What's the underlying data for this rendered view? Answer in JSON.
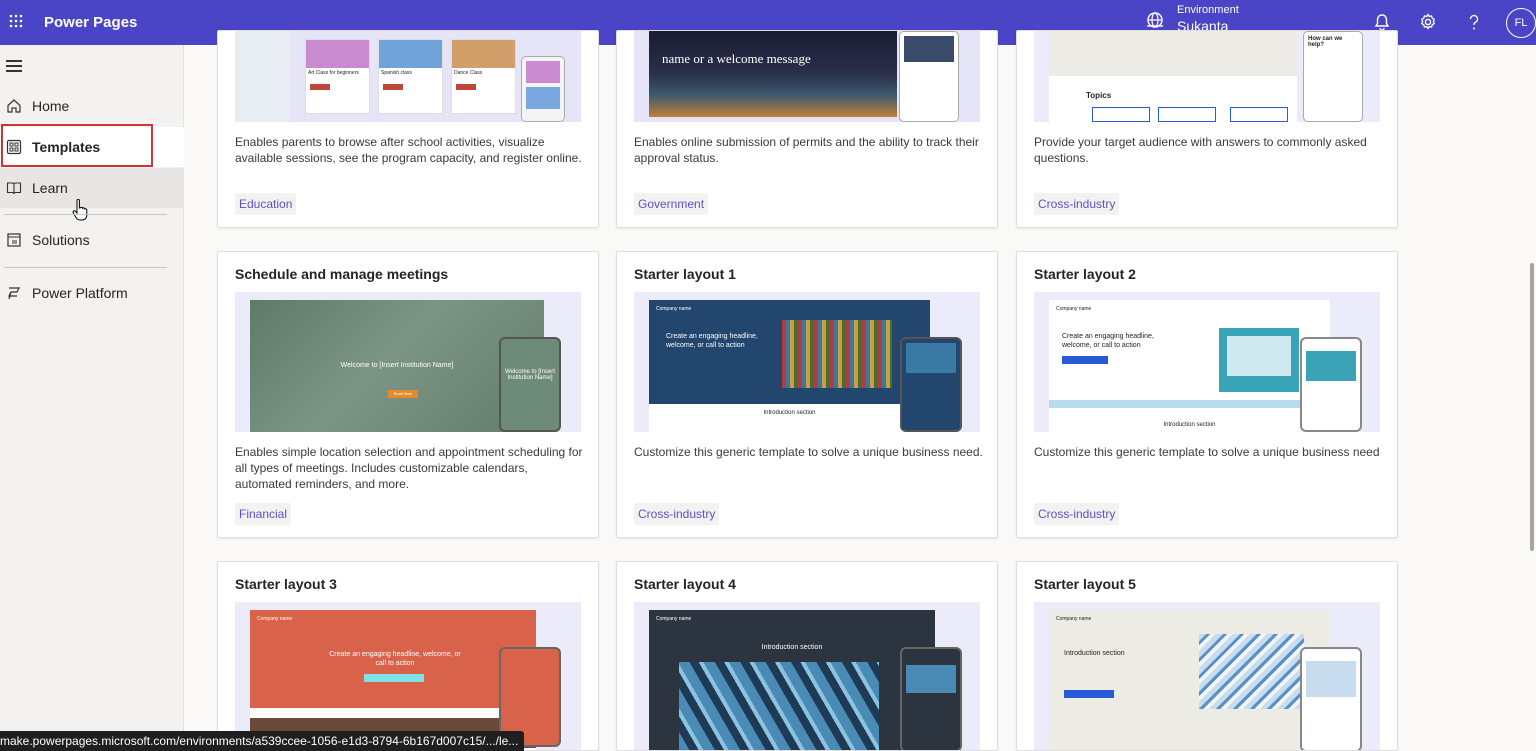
{
  "topbar": {
    "app_title": "Power Pages",
    "environment_label": "Environment",
    "environment_name": "Sukanta",
    "user_initials": "FL",
    "icons": [
      "waffle-icon",
      "globe-icon",
      "bell-icon",
      "gear-icon",
      "help-icon"
    ]
  },
  "sidebar": {
    "items": [
      {
        "label": "Home",
        "icon": "home-icon"
      },
      {
        "label": "Templates",
        "icon": "templates-icon",
        "selected": true
      },
      {
        "label": "Learn",
        "icon": "book-icon"
      },
      {
        "label": "Solutions",
        "icon": "solutions-icon"
      },
      {
        "label": "Power Platform",
        "icon": "power-platform-icon"
      }
    ]
  },
  "cards": [
    {
      "title": "",
      "description": "Enables parents to browse after school activities, visualize available sessions, see the program capacity, and register online.",
      "tag": "Education",
      "preview_text": [
        "Art Class for beginners",
        "Spanish class",
        "Dance Class"
      ]
    },
    {
      "title": "",
      "description": "Enables online submission of permits and the ability to track their approval status.",
      "tag": "Government",
      "preview_text": [
        "name or a welcome message"
      ]
    },
    {
      "title": "",
      "description": "Provide your target audience with answers to commonly asked questions.",
      "tag": "Cross-industry",
      "preview_text": [
        "Topics",
        "How can we help?"
      ]
    },
    {
      "title": "Schedule and manage meetings",
      "description": "Enables simple location selection and appointment scheduling for all types of meetings. Includes customizable calendars, automated reminders, and more.",
      "tag": "Financial",
      "preview_text": [
        "Welcome to [Insert Institution Name]",
        "Book Now",
        "Welcome to [Insert Institution Name]"
      ]
    },
    {
      "title": "Starter layout 1",
      "description": "Customize this generic template to solve a unique business need.",
      "tag": "Cross-industry",
      "preview_text": [
        "Company name",
        "Create an engaging headline, welcome, or call to action",
        "Introduction section"
      ]
    },
    {
      "title": "Starter layout 2",
      "description": "Customize this generic template to solve a unique business need",
      "tag": "Cross-industry",
      "preview_text": [
        "Company name",
        "Create an engaging headline, welcome, or call to action",
        "Introduction section"
      ]
    },
    {
      "title": "Starter layout 3",
      "description": "",
      "tag": "",
      "preview_text": [
        "Company name",
        "Create an engaging headline, welcome, or call to action"
      ]
    },
    {
      "title": "Starter layout 4",
      "description": "",
      "tag": "",
      "preview_text": [
        "Company name",
        "Introduction section"
      ]
    },
    {
      "title": "Starter layout 5",
      "description": "",
      "tag": "",
      "preview_text": [
        "Company name",
        "Introduction section"
      ]
    }
  ],
  "status_url": "make.powerpages.microsoft.com/environments/a539ccee-1056-e1d3-8794-6b167d007c15/.../le..."
}
